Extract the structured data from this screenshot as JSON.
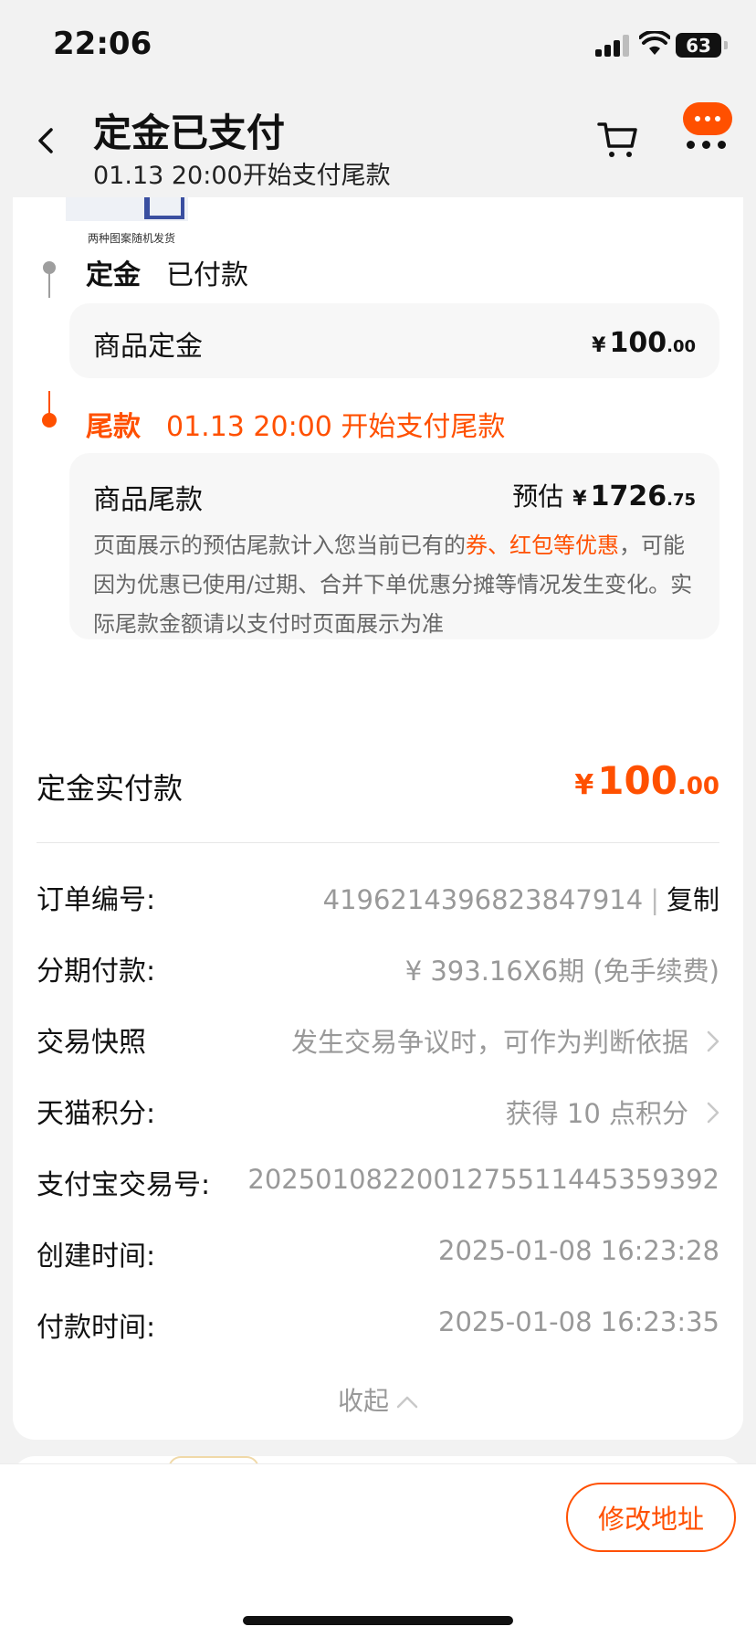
{
  "status_bar": {
    "time": "22:06",
    "battery": "63"
  },
  "header": {
    "title": "定金已支付",
    "subtitle": "01.13 20:00开始支付尾款"
  },
  "product": {
    "caption": "两种图案随机发货"
  },
  "deposit_stage": {
    "label": "定金",
    "status": "已付款",
    "item_label": "商品定金",
    "price": {
      "currency": "¥",
      "int": "100",
      "dec": ".00"
    }
  },
  "final_stage": {
    "label": "尾款",
    "status": "01.13 20:00 开始支付尾款",
    "item_label": "商品尾款",
    "estimate_label": "预估",
    "price": {
      "currency": "¥",
      "int": "1726",
      "dec": ".75"
    },
    "note_prefix": "页面展示的预估尾款计入您当前已有的",
    "note_highlight": "券、红包等优惠",
    "note_suffix": "，可能因为优惠已使用/过期、合并下单优惠分摊等情况发生变化。实际尾款金额请以支付时页面展示为准"
  },
  "deposit_paid": {
    "label": "定金实付款",
    "price": {
      "currency": "¥",
      "int": "100",
      "dec": ".00"
    }
  },
  "info": {
    "order_no": {
      "label": "订单编号:",
      "value": "4196214396823847914",
      "separator": "|",
      "action": "复制"
    },
    "installment": {
      "label": "分期付款:",
      "value": "¥ 393.16X6期 (免手续费)"
    },
    "snapshot": {
      "label": "交易快照",
      "value": "发生交易争议时，可作为判断依据"
    },
    "points": {
      "label": "天猫积分:",
      "value": "获得 10 点积分"
    },
    "alipay_no": {
      "label": "支付宝交易号:",
      "value": "2025010822001275511445359392"
    },
    "created": {
      "label": "创建时间:",
      "value": "2025-01-08 16:23:28"
    },
    "paid": {
      "label": "付款时间:",
      "value": "2025-01-08 16:23:35"
    }
  },
  "collapse_label": "收起",
  "bottom": {
    "modify_address": "修改地址"
  },
  "colors": {
    "accent": "#ff5000",
    "muted": "#999999",
    "timeline_gray": "#9e9e9e"
  }
}
